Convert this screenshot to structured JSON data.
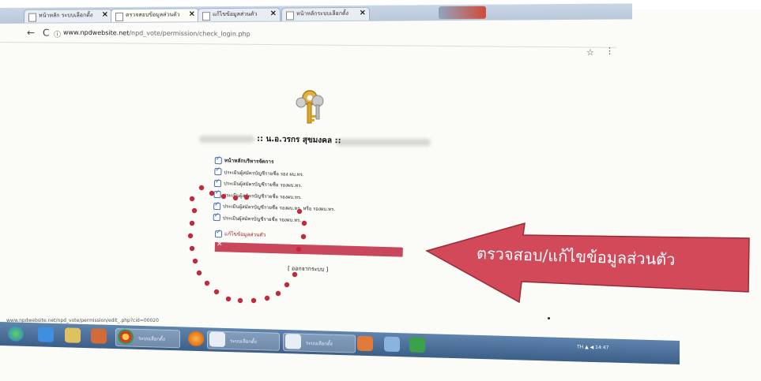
{
  "browser": {
    "tabs": [
      {
        "label": "หน้าหลัก ระบบเลือกตั้ง"
      },
      {
        "label": "ตรวจสอบข้อมูลส่วนตัว"
      },
      {
        "label": "แก้ไขข้อมูลส่วนตัว"
      },
      {
        "label": "หน้าหลักระบบเลือกตั้ง"
      }
    ],
    "nav": {
      "back_icon": "←",
      "reload_icon": "C",
      "info_icon": "ⓘ"
    },
    "url": {
      "host": "www.npdwebsite.net",
      "path": "/npd_vote/permission/check_login.php"
    },
    "star_icon": "☆",
    "menu_icon": "⋮"
  },
  "page": {
    "heading": ":: น.อ.วรกร สุขมงคล ::",
    "menu_items": [
      {
        "label": "หน้าหลักบริหารจัดการ",
        "bold": true
      },
      {
        "label": "ประเมินผู้สมัครบัญชีรายชื่อ รอง ผบ.ทร.",
        "bold": false
      },
      {
        "label": "ประเมินผู้สมัครบัญชีรายชื่อ รองผบ.ทร.",
        "bold": false
      },
      {
        "label": "ประเมินผู้สมัครบัญชีรายชื่อ รองผบ.ทร.",
        "bold": false
      },
      {
        "label": "ประเมินผู้สมัครบัญชีรายชื่อ รองผบ.ทร. หรือ รองผบ.ทร.",
        "bold": false
      },
      {
        "label": "ประเมินผู้สมัครบัญชีรายชื่อ รองผบ.ทร.",
        "bold": false
      }
    ],
    "edit_label": "แก้ไขข้อมูลส่วนตัว",
    "logout_label": "[ ออกจากระบบ ]"
  },
  "annotation": {
    "arrow_text": "ตรวจสอบ/แก้ไขข้อมูลส่วนตัว",
    "arrow_color": "#d24a5a"
  },
  "status_url": "www.npdwebsite.net/npd_vote/permission/edit_.php?cid=00020",
  "taskbar": {
    "windows": [
      {
        "label": "ระบบเลือกตั้ง"
      },
      {
        "label": "ระบบเลือกตั้ง"
      },
      {
        "label": "ระบบเลือกตั้ง"
      }
    ],
    "tray_text": "TH ▲ ◀ 14:47"
  }
}
